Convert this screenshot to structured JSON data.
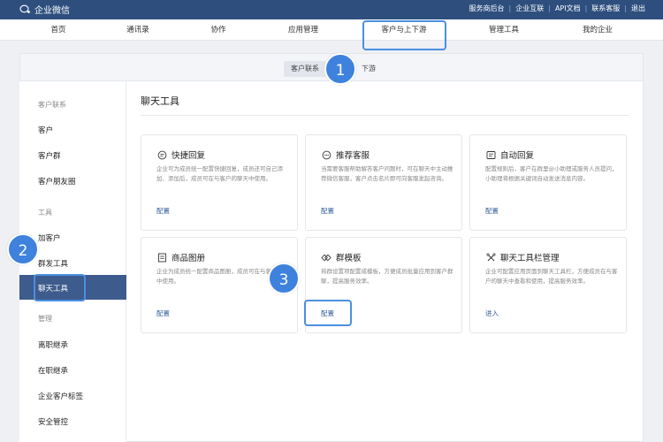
{
  "app": {
    "title": "企业微信"
  },
  "top_links": [
    "服务商后台",
    "企业互联",
    "API文档",
    "联系客服",
    "退出"
  ],
  "main_nav": [
    "首页",
    "通讯录",
    "协作",
    "应用管理",
    "客户与上下游",
    "管理工具",
    "我的企业"
  ],
  "sub_tabs": {
    "tab1": "客户联系",
    "tab2_suffix": "下游"
  },
  "sidebar": {
    "group_customer": "客户联系",
    "customer": "客户",
    "customer_group": "客户群",
    "moments": "客户朋友圈",
    "group_tools": "工具",
    "add_customer": "加客户",
    "mass_send": "群发工具",
    "chat_tools": "聊天工具",
    "group_manage": "管理",
    "resign_inherit": "离职继承",
    "onjob_inherit": "在职继承",
    "tags": "企业客户标签",
    "security": "安全管控"
  },
  "content": {
    "title": "聊天工具"
  },
  "cards": [
    {
      "title": "快捷回复",
      "desc": "企业可为成员统一配置快捷回复，成员还可自己添加、添加后，成员可在与客户的聊天中使用。",
      "link": "配置",
      "icon": "chat-bubble-icon"
    },
    {
      "title": "推荐客服",
      "desc": "当需要客服帮助解答客户问题时，可在聊天中主动推荐微信客服，客户点击名片即可向客服发起咨询。",
      "link": "配置",
      "icon": "service-icon"
    },
    {
      "title": "自动回复",
      "desc": "配置规则后，客户在群里@小助理或服务人员提问，小助理将根据关键词自动发送消息内容。",
      "link": "配置",
      "icon": "auto-reply-icon"
    },
    {
      "title": "商品图册",
      "desc": "企业为成员统一配置商品图册，成员可在与客户沟通中使用。",
      "link": "配置",
      "icon": "album-icon"
    },
    {
      "title": "群模板",
      "desc": "将群设置项配置成模板，方便成员批量应用到客户群聊，提高服务效率。",
      "link": "配置",
      "icon": "template-icon"
    },
    {
      "title": "聊天工具栏管理",
      "desc": "企业可配置应用页面到聊天工具栏，方便成员在与客户的聊天中查看和使用，提高服务效率。",
      "link": "进入",
      "icon": "toolbar-icon"
    }
  ],
  "badges": [
    "1",
    "2",
    "3"
  ],
  "colors": {
    "topbar": "#2e4f7e",
    "active_sidebar": "#3d5b8c",
    "highlight": "#4a90e2",
    "link": "#2c5a9a"
  }
}
